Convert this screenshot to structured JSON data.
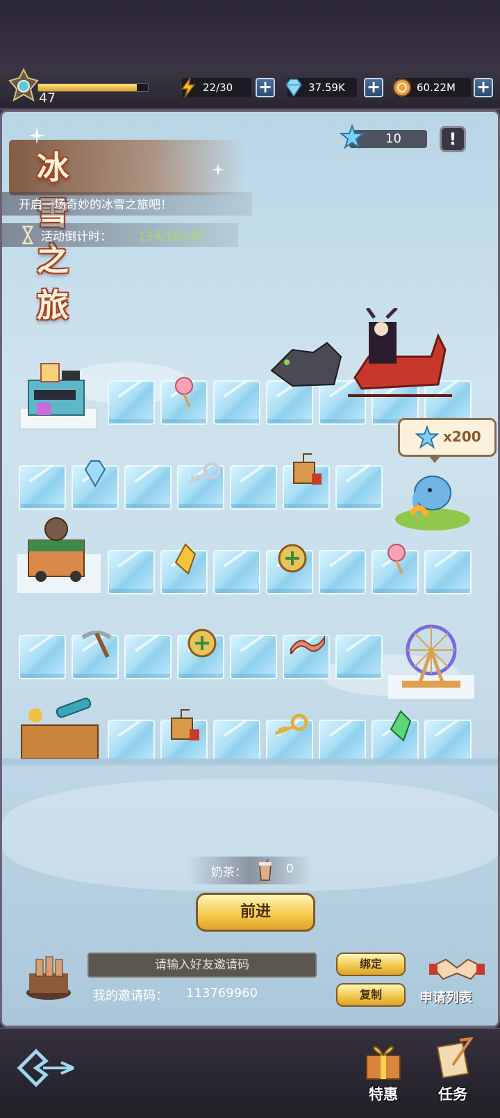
{
  "header": {
    "player_level": "47",
    "xp_progress": 0.9,
    "energy": "22/30",
    "gems": "37.59K",
    "coins": "60.22M"
  },
  "event": {
    "title": "冰雪之旅",
    "subtitle": "开启一场奇妙的冰雪之旅吧！",
    "countdown_label": "活动倒计时：",
    "countdown_value": "13天16小时",
    "stars": "10",
    "info": "!"
  },
  "board": {
    "reward_bubble": "x200",
    "buildings": [
      "cinema",
      "milk-tea-cart",
      "elephant-fountain",
      "ferris-wheel",
      "telescope-deck"
    ],
    "items": [
      "lollipop",
      "diamond",
      "key",
      "tnt",
      "gold-crystal",
      "coin",
      "lollipop",
      "pickaxe",
      "coin",
      "bacon",
      "tnt",
      "key",
      "green-crystal"
    ]
  },
  "controls": {
    "milk_label": "奶茶：",
    "milk_count": "0",
    "advance_label": "前进",
    "invite_placeholder": "请输入好友邀请码",
    "my_code_label": "我的邀请码：",
    "my_code_value": "113769960",
    "bind_label": "绑定",
    "copy_label": "复制",
    "apply_list_label": "申请列表"
  },
  "nav": {
    "special_offer": "特惠",
    "tasks": "任务"
  },
  "colors": {
    "accent_gold": "#f3c94a",
    "countdown_green": "#9fe05a",
    "title_red": "#b5452a",
    "ice": "#a9def4"
  }
}
